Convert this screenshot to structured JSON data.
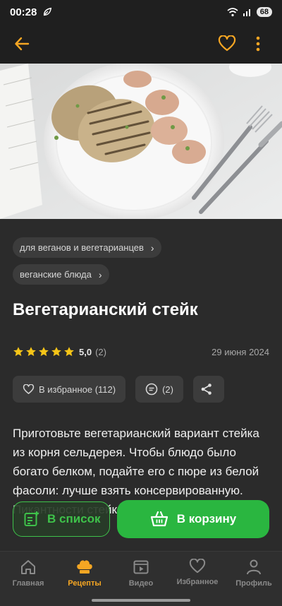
{
  "status_bar": {
    "time": "00:28",
    "battery": "68"
  },
  "colors": {
    "accent": "#f5a623",
    "green": "#2ab640",
    "background": "#2b2b2b"
  },
  "top_bar": {
    "back_icon": "arrow-left-icon",
    "favorite_icon": "heart-icon",
    "menu_icon": "more-vertical-icon"
  },
  "recipe": {
    "tags": [
      "для веганов и вегетарианцев",
      "веганские блюда"
    ],
    "title": "Вегетарианский стейк",
    "rating_value": "5,0",
    "rating_count": "(2)",
    "rating_stars": 5,
    "date": "29 июня 2024",
    "description": "Приготовьте вегетарианский вариант стейка из корня сельдерея. Чтобы блюдо было богато белком, подайте его с пюре из белой фасоли: лучше взять консервированную. Пикантности стейкам добавит"
  },
  "actions": {
    "favorite_label": "В избранное (112)",
    "comments_label": "(2)"
  },
  "floating": {
    "list_label": "В список",
    "cart_label": "В корзину"
  },
  "nav": {
    "items": [
      {
        "label": "Главная",
        "icon": "home-icon"
      },
      {
        "label": "Рецепты",
        "icon": "chef-hat-icon"
      },
      {
        "label": "Видео",
        "icon": "video-icon"
      },
      {
        "label": "Избранное",
        "icon": "heart-icon"
      },
      {
        "label": "Профиль",
        "icon": "profile-icon"
      }
    ],
    "active_index": 1
  }
}
